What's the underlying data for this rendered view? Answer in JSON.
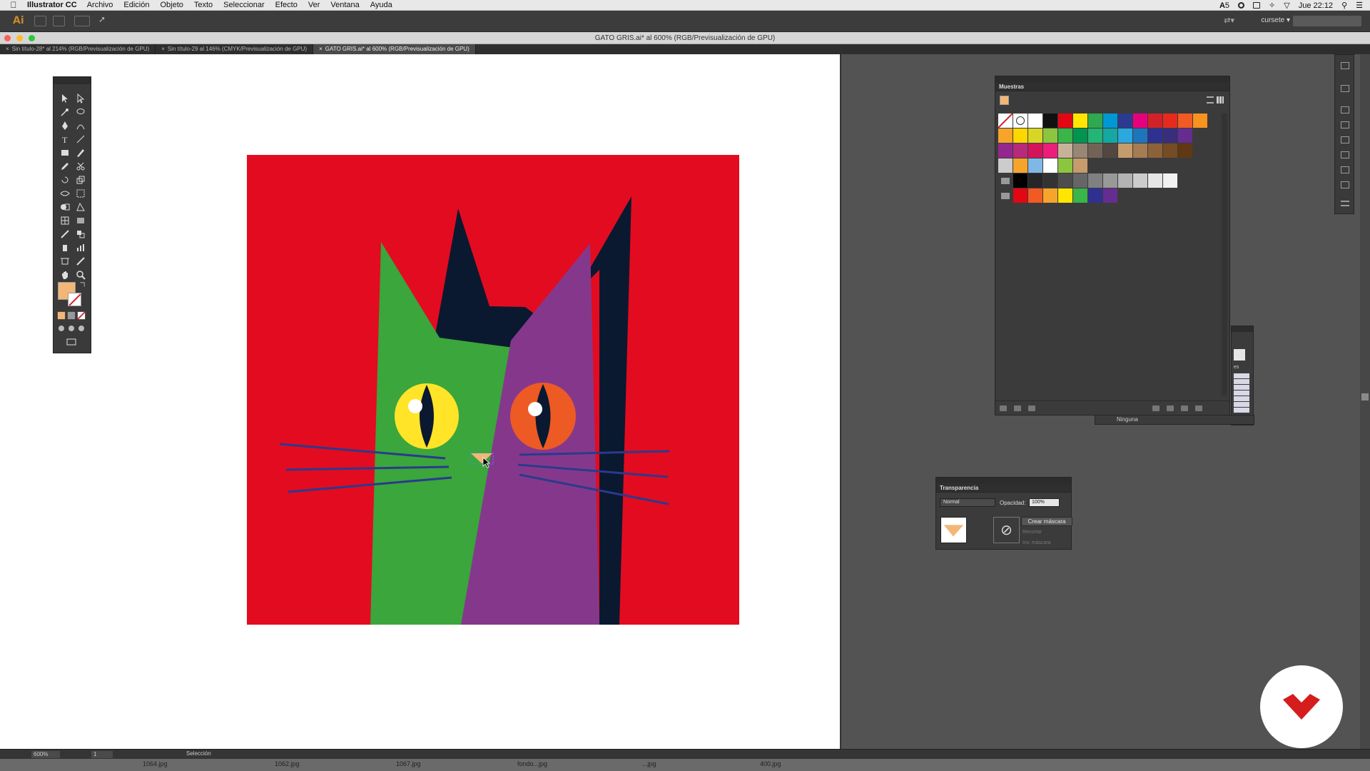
{
  "menubar": {
    "app": "Illustrator CC",
    "items": [
      "Archivo",
      "Edición",
      "Objeto",
      "Texto",
      "Seleccionar",
      "Efecto",
      "Ver",
      "Ventana",
      "Ayuda"
    ],
    "status_battery": "5",
    "clock": "Jue 22:12"
  },
  "appbar": {
    "logo": "Ai",
    "workspace": "cursete",
    "workspace_arrow": "▾",
    "sync": "⇄▾"
  },
  "document": {
    "title": "GATO GRIS.ai* al 600% (RGB/Previsualización de GPU)"
  },
  "tabs": [
    {
      "label": "Sin título-28* al 214% (RGB/Previsualización de GPU)",
      "close": "×"
    },
    {
      "label": "Sin título-29 al 146% (CMYK/Previsualización de GPU)",
      "close": "×"
    },
    {
      "label": "GATO GRIS.ai* al 600% (RGB/Previsualización de GPU)",
      "close": "×"
    }
  ],
  "swatches_panel": {
    "title": "Muestras",
    "rows": [
      [
        "#ffffff",
        "#ffffff",
        "#ffffff",
        "#111111",
        "#e30613",
        "#ffe600",
        "#2fa84f",
        "#0098d4",
        "#2c3b8f",
        "#e6007e",
        "#d0222b",
        "#e62b1e",
        "#f15a24",
        "#f7931e"
      ],
      [
        "#f7a42c",
        "#ffd700",
        "#d7d624",
        "#8cc63f",
        "#39b54a",
        "#00944f",
        "#22b573",
        "#16a7a2",
        "#2aa8e0",
        "#1f75bc",
        "#2e3192",
        "#3a2d7b",
        "#662d91"
      ],
      [
        "#93278f",
        "#b72a7b",
        "#d4145a",
        "#ed1e79",
        "#c7b299",
        "#998675",
        "#736357",
        "#534741",
        "#c69c6d",
        "#a67c52",
        "#8c6239",
        "#754c24",
        "#603813"
      ],
      [
        "#cccccc",
        "#f7a42c",
        "#7fb8e6",
        "#ffffff",
        "#8cc63f",
        "#c69c6d"
      ],
      [
        "#000000",
        "#262626",
        "#333333",
        "#4d4d4d",
        "#666666",
        "#808080",
        "#999999",
        "#b3b3b3",
        "#cccccc",
        "#e6e6e6",
        "#f2f2f2"
      ],
      [
        "#e30613",
        "#f15a24",
        "#f7a42c",
        "#ffe600",
        "#39b54a",
        "#2e3192",
        "#662d91"
      ]
    ],
    "fill_color": "#f2b776"
  },
  "mini_panel": {
    "label": "es",
    "bottom_label": "Ninguna"
  },
  "transparency": {
    "title": "Transparencia",
    "blend_mode": "Normal",
    "opacity_label": "Opacidad:",
    "opacity_value": "100%",
    "make_mask": "Crear máscara",
    "clip": "Recortar",
    "invert": "Inv. máscara"
  },
  "status": {
    "zoom": "600%",
    "page": "1",
    "tool": "Selección"
  },
  "os_strip": {
    "files": [
      "1064.jpg",
      "1062.jpg",
      "1067.jpg",
      "fondo...jpg",
      "...jpg",
      "400.jpg"
    ]
  },
  "artwork": {
    "background": "#e30b20",
    "cat_green": "#3aa63c",
    "cat_purple": "#85388b",
    "cat_navy": "#0a1930",
    "eye_left": "#ffe428",
    "eye_right": "#ee5a24",
    "whiskers": "#2b3a8c",
    "nose": "#f2b776"
  }
}
